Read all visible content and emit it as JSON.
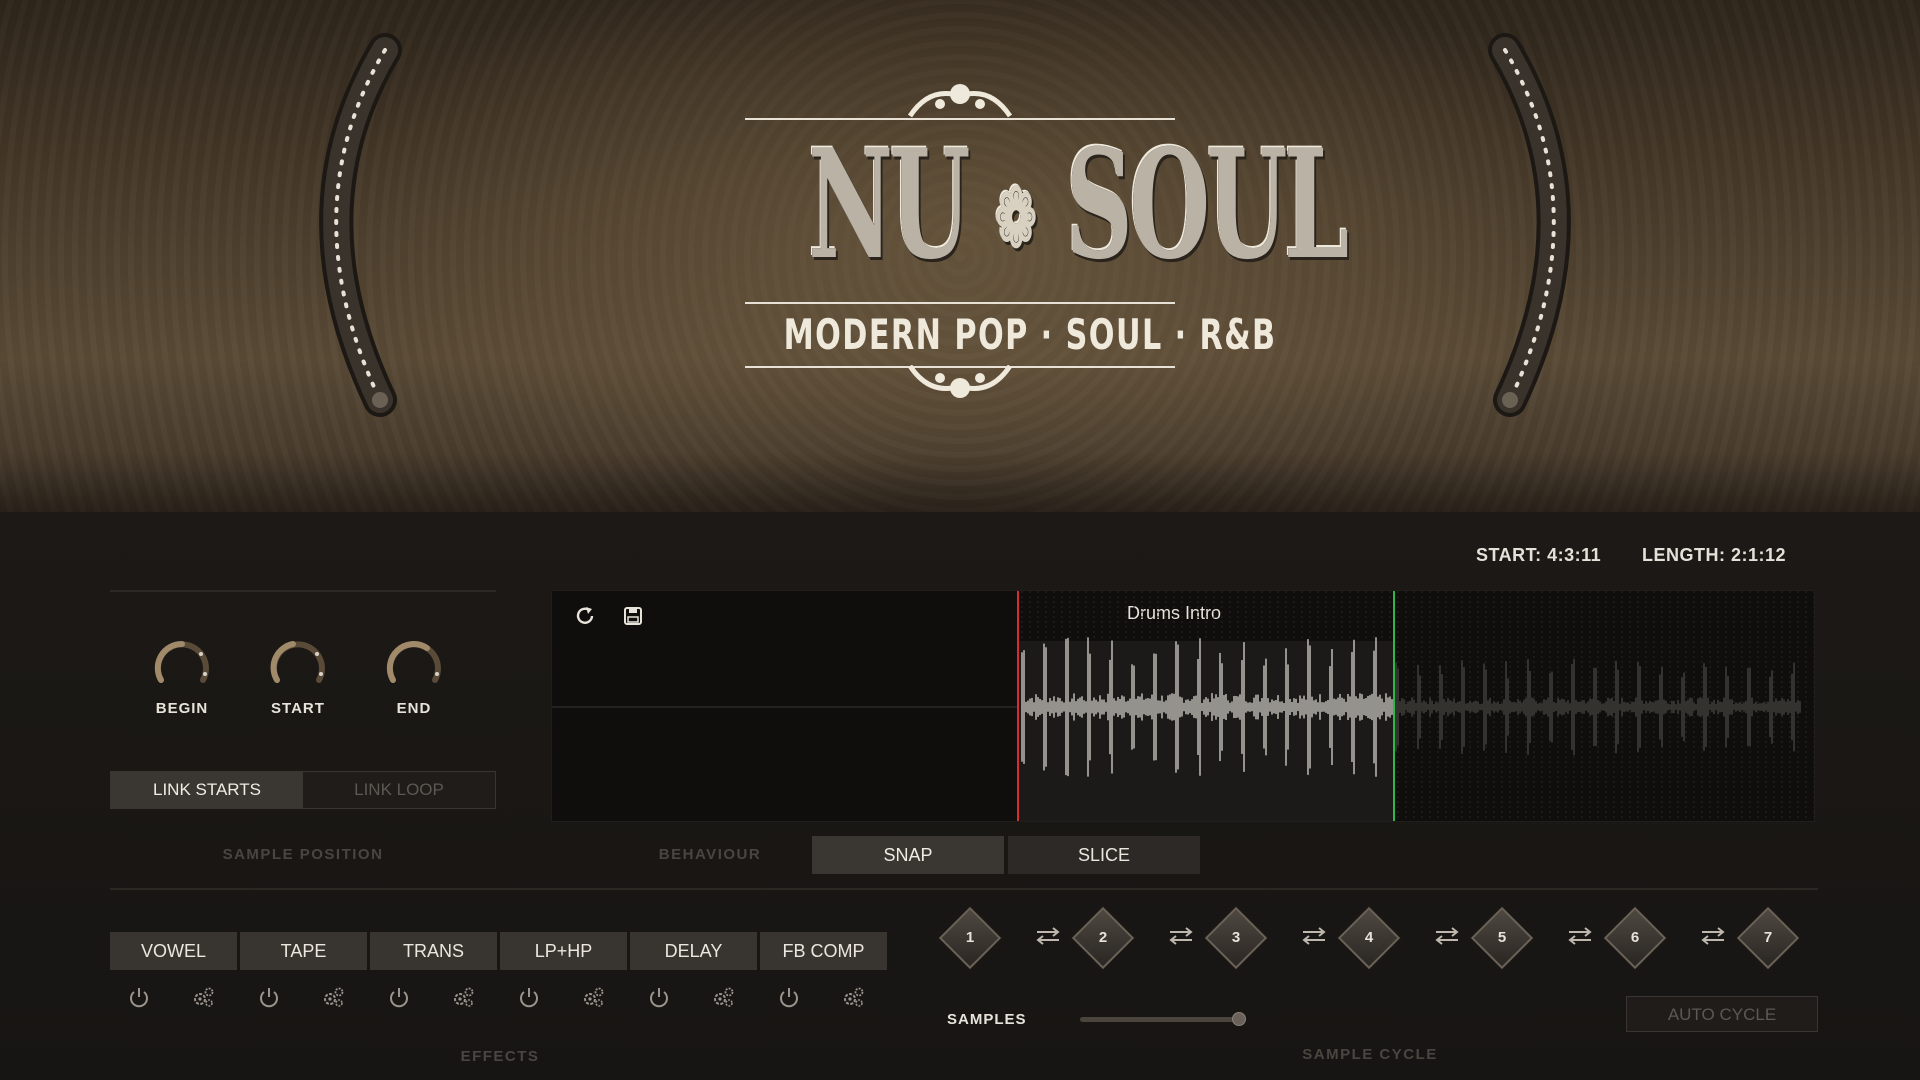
{
  "header": {
    "logo_title_left": "NU",
    "logo_title_right": "SOUL",
    "logo_subtitle": "MODERN POP · SOUL · R&B",
    "colors": {
      "background": "#4a3c2b",
      "logo_text": "#efe9dc"
    }
  },
  "info": {
    "start": "START: 4:3:11",
    "length": "LENGTH: 2:1:12"
  },
  "sample_position": {
    "label": "SAMPLE POSITION",
    "knobs": [
      {
        "label": "BEGIN",
        "value": 0.55
      },
      {
        "label": "START",
        "value": 0.5
      },
      {
        "label": "END",
        "value": 0.7
      }
    ],
    "link_starts": {
      "label": "LINK STARTS",
      "active": true
    },
    "link_loop": {
      "label": "LINK LOOP",
      "active": false
    }
  },
  "waveform": {
    "title": "Drums Intro",
    "refresh_icon": "refresh-icon",
    "save_icon": "save-icon",
    "start_marker_color": "#d03030",
    "end_marker_color": "#2fb84a"
  },
  "behaviour": {
    "label": "BEHAVIOUR",
    "snap_label": "SNAP",
    "slice_label": "SLICE",
    "snap_active": true
  },
  "effects": {
    "label": "EFFECTS",
    "items": [
      {
        "label": "VOWEL"
      },
      {
        "label": "TAPE"
      },
      {
        "label": "TRANS"
      },
      {
        "label": "LP+HP"
      },
      {
        "label": "DELAY"
      },
      {
        "label": "FB COMP"
      }
    ],
    "power_icon": "power-icon",
    "settings_icon": "gears-icon"
  },
  "sample_cycle": {
    "label": "SAMPLE CYCLE",
    "slots": [
      "1",
      "2",
      "3",
      "4",
      "5",
      "6",
      "7"
    ],
    "swap_icon": "swap-arrows-icon",
    "samples_label": "SAMPLES",
    "samples_value": 1.0,
    "auto_cycle_label": "AUTO CYCLE"
  }
}
